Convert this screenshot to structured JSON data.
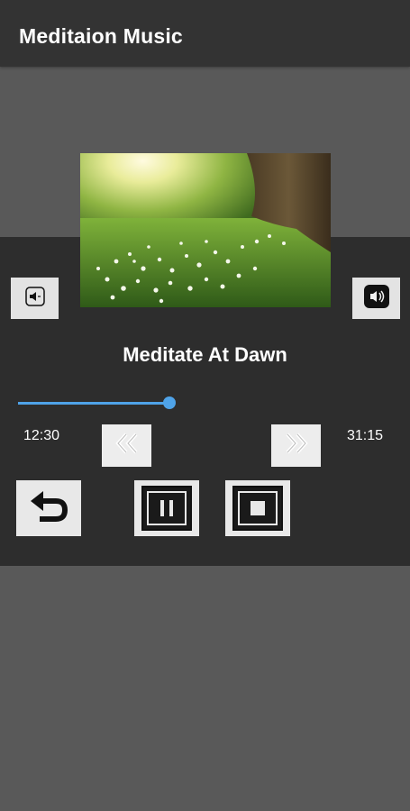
{
  "app": {
    "title": "Meditaion Music"
  },
  "player": {
    "track_title": "Meditate At Dawn",
    "time_elapsed": "12:30",
    "time_total": "31:15",
    "progress": 0.4,
    "artwork_description": "grass-field-tree-sunrise"
  },
  "icons": {
    "volume_down": "speaker-minus-icon",
    "volume_up": "speaker-plus-icon",
    "rewind": "double-chevron-left-icon",
    "forward": "double-chevron-right-icon",
    "replay": "return-arrow-icon",
    "pause": "pause-icon",
    "stop": "stop-icon"
  },
  "colors": {
    "app_bar": "#333333",
    "background": "#595959",
    "panel": "#2d2d2d",
    "accent": "#4fa3e8",
    "button": "#e8e8e8"
  }
}
